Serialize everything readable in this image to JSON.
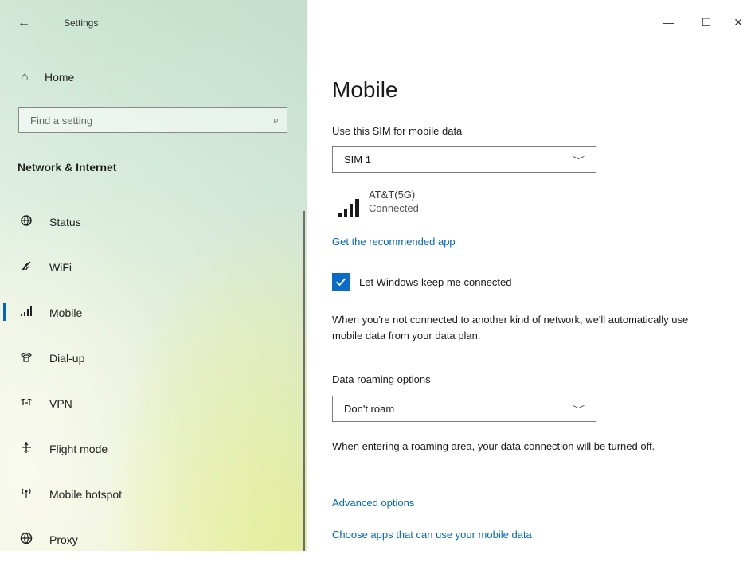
{
  "window": {
    "title": "Settings",
    "controls": {
      "minimize": "—",
      "maximize": "☐",
      "close": "✕"
    }
  },
  "sidebar": {
    "back_icon": "←",
    "home": {
      "icon": "⌂",
      "label": "Home"
    },
    "search": {
      "placeholder": "Find a setting",
      "icon": "⌕"
    },
    "section_heading": "Network & Internet",
    "items": [
      {
        "label": "Status",
        "icon": "globe-icon",
        "glyph": "⊕",
        "selected": false
      },
      {
        "label": "WiFi",
        "icon": "wifi-icon",
        "glyph": "◜",
        "selected": false
      },
      {
        "label": "Mobile",
        "icon": "cellular-icon",
        "glyph": "▁▃▅",
        "selected": true
      },
      {
        "label": "Dial-up",
        "icon": "phone-icon",
        "glyph": "☎",
        "selected": false
      },
      {
        "label": "VPN",
        "icon": "vpn-icon",
        "glyph": "∞",
        "selected": false
      },
      {
        "label": "Flight mode",
        "icon": "airplane-icon",
        "glyph": "✈",
        "selected": false
      },
      {
        "label": "Mobile hotspot",
        "icon": "hotspot-icon",
        "glyph": "((•))",
        "selected": false
      },
      {
        "label": "Proxy",
        "icon": "proxy-globe-icon",
        "glyph": "⊕",
        "selected": false
      }
    ]
  },
  "main": {
    "title": "Mobile",
    "sim_label": "Use this SIM for mobile data",
    "sim_value": "SIM 1",
    "carrier": {
      "name": "AT&T(5G)",
      "status": "Connected",
      "signal_bars": 4
    },
    "recommended_link": "Get the recommended app",
    "keep_connected": {
      "label": "Let Windows keep me connected",
      "checked": true
    },
    "keep_connected_desc": "When you're not connected to another kind of network, we'll automatically use mobile data from your data plan.",
    "roaming_label": "Data roaming options",
    "roaming_value": "Don't roam",
    "roaming_desc": "When entering a roaming area, your data connection will be turned off.",
    "advanced_link": "Advanced options",
    "apps_link": "Choose apps that can use your mobile data"
  },
  "colors": {
    "accent": "#0067c0",
    "checkbox": "#0a6cc7"
  }
}
